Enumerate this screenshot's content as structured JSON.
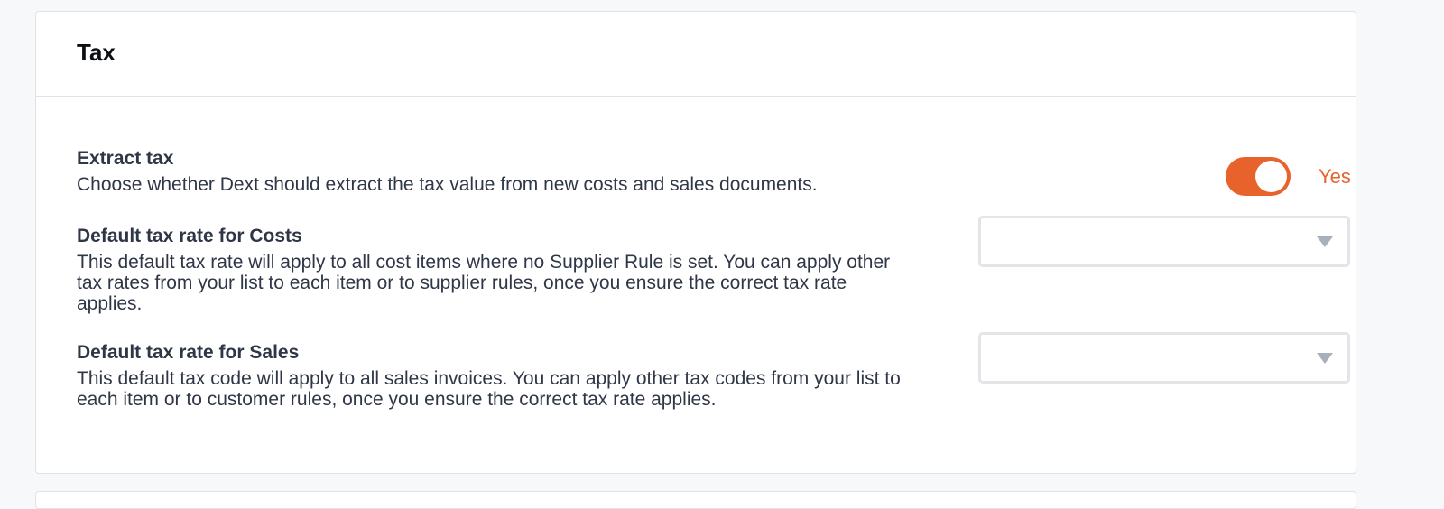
{
  "card": {
    "title": "Tax"
  },
  "settings": {
    "extract_tax": {
      "label": "Extract tax",
      "description": "Choose whether Dext should extract the tax value from new costs and sales documents.",
      "toggle_on": true,
      "toggle_text": "Yes"
    },
    "default_tax_costs": {
      "label": "Default tax rate for Costs",
      "description": "This default tax rate will apply to all cost items where no Supplier Rule is set. You can apply other tax rates from your list to each item or to supplier rules, once you ensure the correct tax rate applies.",
      "selected": ""
    },
    "default_tax_sales": {
      "label": "Default tax rate for Sales",
      "description": "This default tax code will apply to all sales invoices. You can apply other tax codes from your list to each item or to customer rules, once you ensure the correct tax rate applies.",
      "selected": ""
    }
  },
  "colors": {
    "accent": "#e8632b",
    "text": "#2f3747",
    "border": "#dfe2e7",
    "background": "#f7f8fa"
  },
  "icons": {
    "select_caret": "chevron-down-icon"
  }
}
